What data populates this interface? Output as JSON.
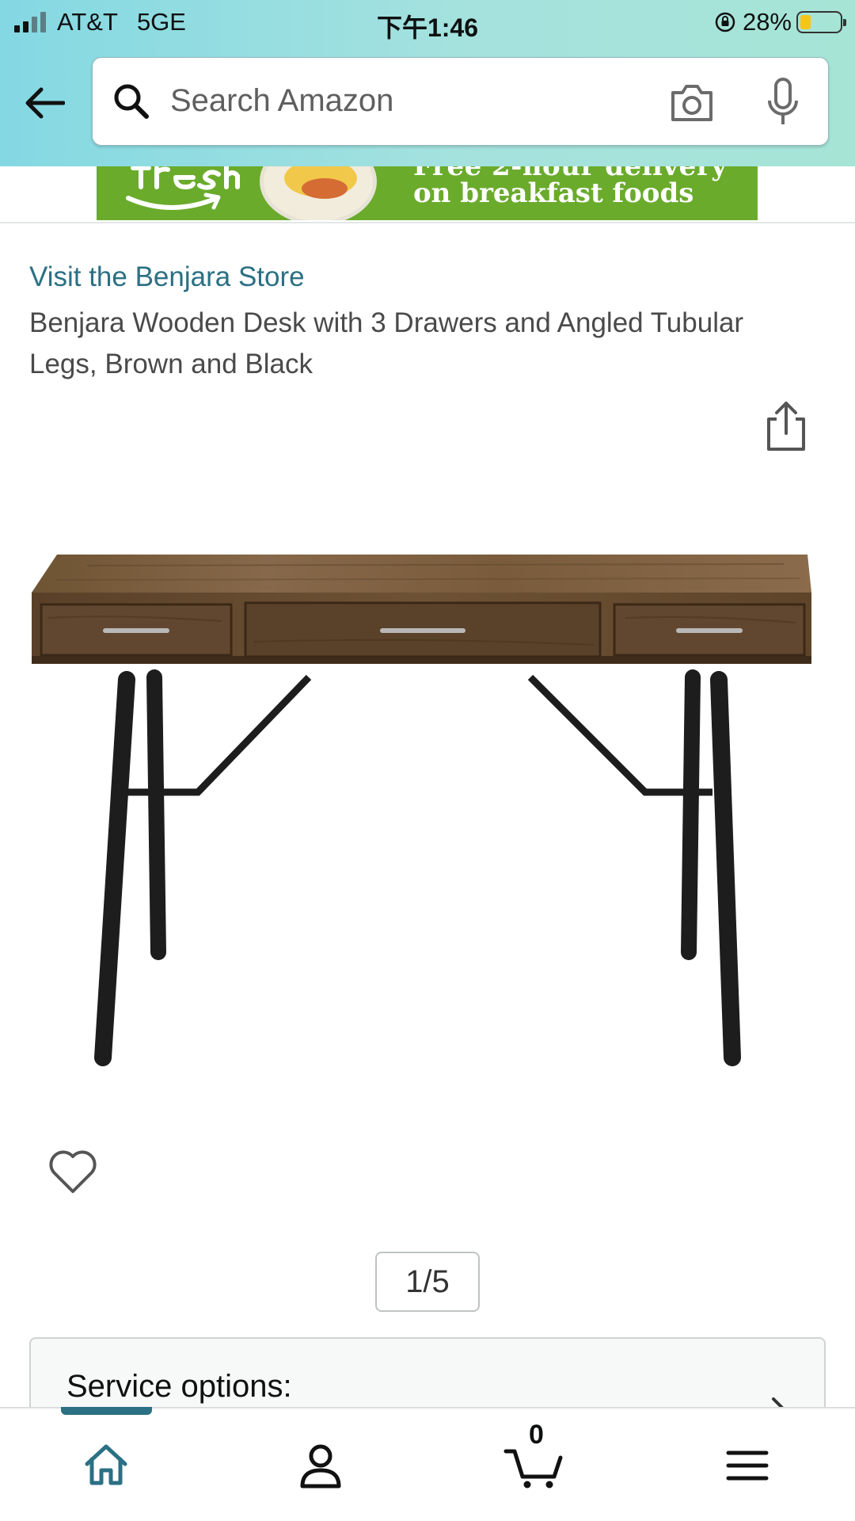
{
  "status_bar": {
    "carrier": "AT&T",
    "network": "5GE",
    "time": "下午1:46",
    "battery_percent": "28%",
    "battery_level": 0.28
  },
  "search": {
    "placeholder": "Search Amazon"
  },
  "banner": {
    "text": "on breakfast foods",
    "partial_top_text": "Free 2-hour delivery",
    "brand_color": "#6aab2c"
  },
  "product": {
    "store_link": "Visit the Benjara Store",
    "title": "Benjara Wooden Desk with 3 Drawers and Angled Tubular Legs, Brown and Black",
    "image_counter": "1/5"
  },
  "service_options": {
    "label": "Service options:"
  },
  "bottom_nav": {
    "items": [
      {
        "name": "home",
        "icon": "home-icon",
        "active": true
      },
      {
        "name": "account",
        "icon": "account-icon"
      },
      {
        "name": "cart",
        "icon": "cart-icon"
      },
      {
        "name": "menu",
        "icon": "menu-icon"
      }
    ],
    "cart_count": "0"
  },
  "colors": {
    "accent": "#2b7084",
    "header_gradient_start": "#84d8e3",
    "header_gradient_end": "#a6e4d6"
  }
}
